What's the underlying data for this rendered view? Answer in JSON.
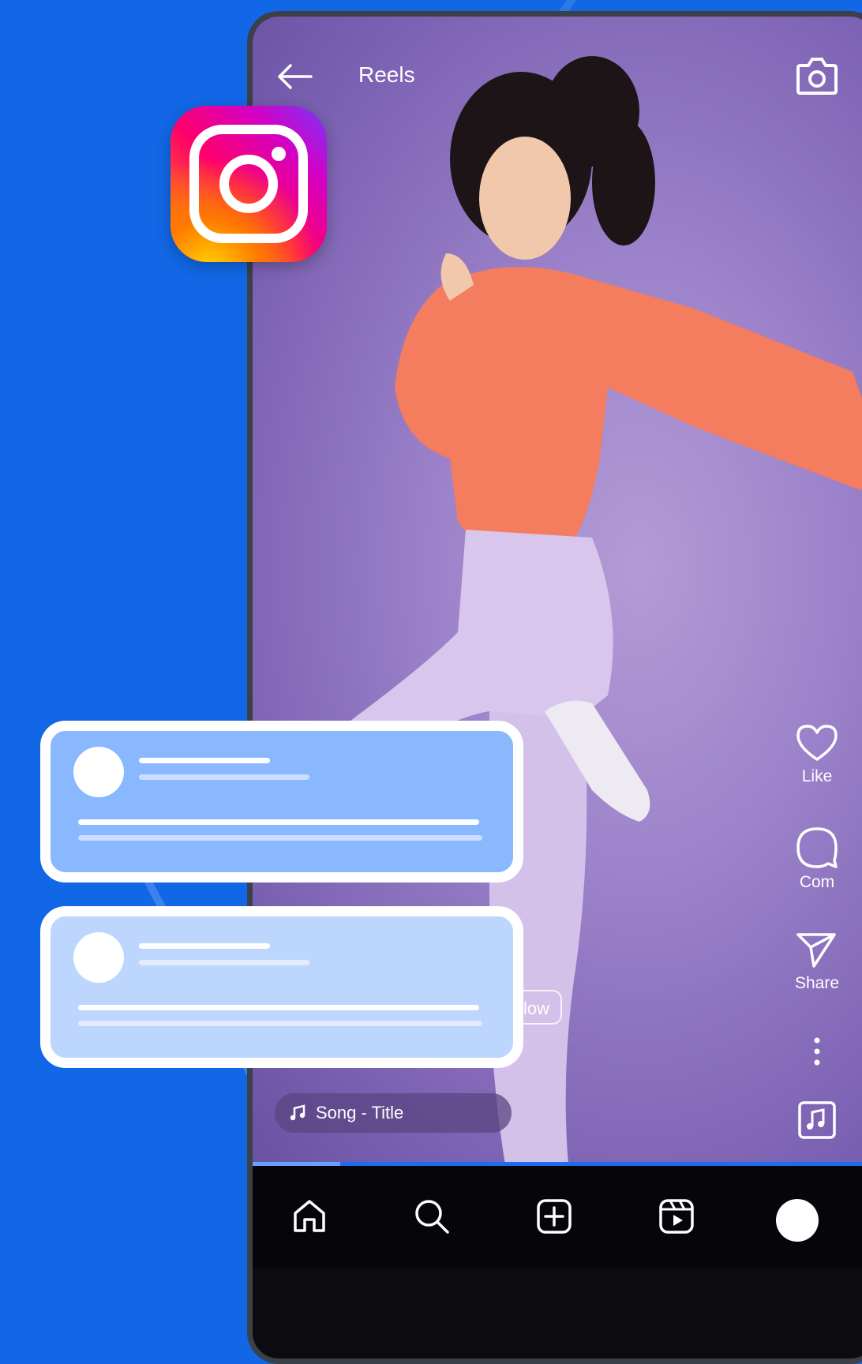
{
  "header": {
    "title": "Reels"
  },
  "actions": {
    "like": "Like",
    "comment": "Com",
    "share": "Share"
  },
  "post": {
    "follow_label": "Follow",
    "song": "Song - Title"
  },
  "playback": {
    "progress": 0.14
  },
  "colors": {
    "background": "#1267e6",
    "nav_bar": "#05050a",
    "card_primary": "#89b8ff",
    "card_secondary": "#bcd6fd"
  },
  "icons": [
    "back-arrow-icon",
    "camera-icon",
    "heart-icon",
    "comment-icon",
    "share-icon",
    "more-icon",
    "music-icon",
    "home-icon",
    "search-icon",
    "add-icon",
    "reels-icon",
    "instagram-logo"
  ]
}
